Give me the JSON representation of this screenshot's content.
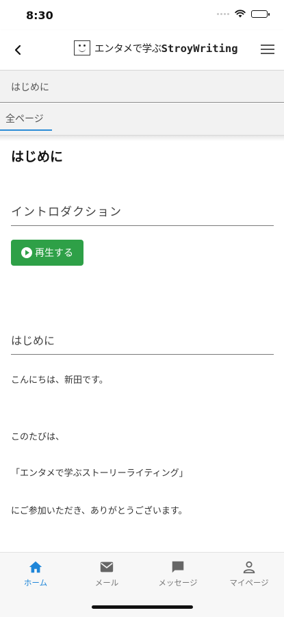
{
  "status": {
    "time": "8:30"
  },
  "header": {
    "logo_text_jp": "エンタメで学ぶ",
    "logo_text_en": "StroyWriting"
  },
  "breadcrumb": {
    "label": "はじめに"
  },
  "tabs": {
    "all_label": "全ページ"
  },
  "main": {
    "title": "はじめに",
    "video_title": "イントロダクション",
    "play_label": "再生する",
    "section_heading": "はじめに",
    "paragraphs": [
      "こんにちは、新田です。",
      "このたびは、",
      "「エンタメで学ぶストーリーライティング」",
      "にご参加いただき、ありがとうございます。"
    ]
  },
  "bottom_nav": {
    "items": [
      {
        "label": "ホーム",
        "icon": "home-icon",
        "active": true
      },
      {
        "label": "メール",
        "icon": "mail-icon",
        "active": false
      },
      {
        "label": "メッセージ",
        "icon": "chat-icon",
        "active": false
      },
      {
        "label": "マイページ",
        "icon": "person-icon",
        "active": false
      }
    ]
  },
  "colors": {
    "accent": "#1f86d9",
    "play_button": "#2ea047"
  }
}
